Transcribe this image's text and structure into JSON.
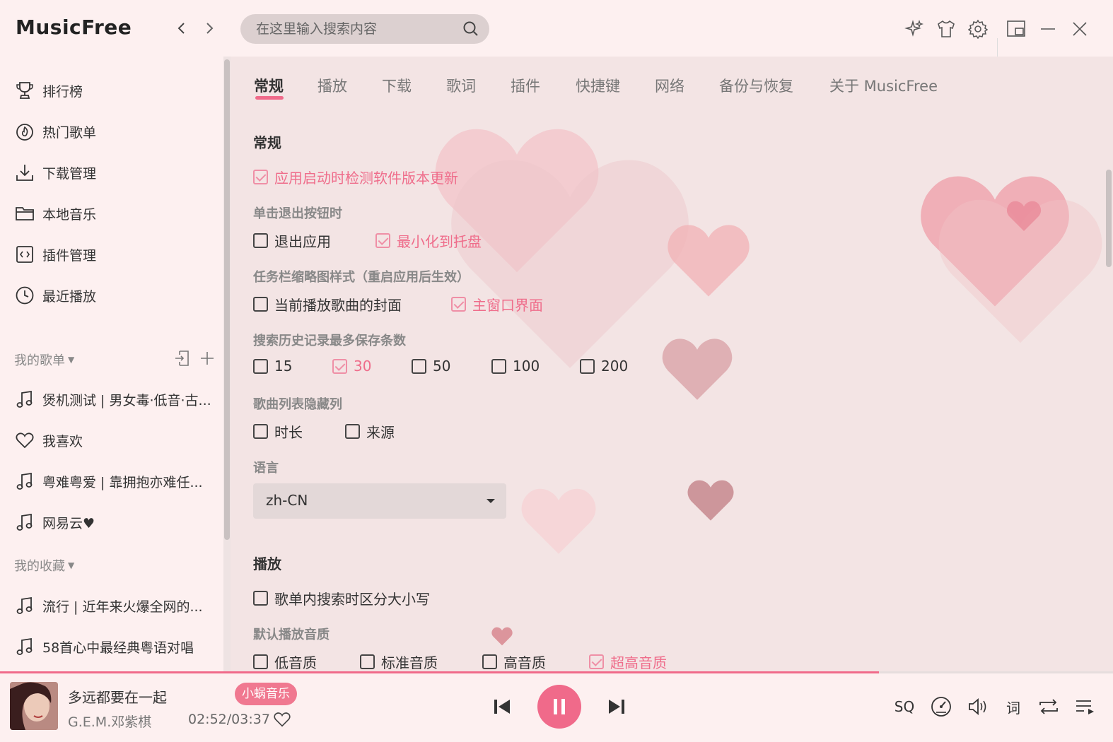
{
  "app": {
    "title": "MusicFree"
  },
  "search": {
    "placeholder": "在这里输入搜索内容"
  },
  "sidebar": {
    "items": [
      {
        "label": "排行榜",
        "icon": "trophy-icon"
      },
      {
        "label": "热门歌单",
        "icon": "fire-icon"
      },
      {
        "label": "下载管理",
        "icon": "download-icon"
      },
      {
        "label": "本地音乐",
        "icon": "folder-icon"
      },
      {
        "label": "插件管理",
        "icon": "plugin-icon"
      },
      {
        "label": "最近播放",
        "icon": "clock-icon"
      }
    ],
    "my_playlists": {
      "title": "我的歌单",
      "items": [
        {
          "label": "煲机测试 | 男女毒·低音·古...",
          "icon": "music-note-icon"
        },
        {
          "label": "我喜欢",
          "icon": "heart-icon"
        },
        {
          "label": "粤难粤爱 | 靠拥抱亦难任...",
          "icon": "music-note-icon"
        },
        {
          "label": "网易云♥",
          "icon": "music-note-icon"
        }
      ]
    },
    "my_favorites": {
      "title": "我的收藏",
      "items": [
        {
          "label": "流行 | 近年来火爆全网的...",
          "icon": "music-note-icon"
        },
        {
          "label": "58首心中最经典粤语对唱",
          "icon": "music-note-icon"
        }
      ]
    }
  },
  "tabs": [
    "常规",
    "播放",
    "下载",
    "歌词",
    "插件",
    "快捷键",
    "网络",
    "备份与恢复",
    "关于 MusicFree"
  ],
  "active_tab": "常规",
  "settings": {
    "general_title": "常规",
    "check_update": {
      "label": "应用启动时检测软件版本更新",
      "checked": true
    },
    "exit_title": "单击退出按钮时",
    "exit_opts": [
      {
        "label": "退出应用",
        "checked": false
      },
      {
        "label": "最小化到托盘",
        "checked": true
      }
    ],
    "taskbar_title": "任务栏缩略图样式（重启应用后生效）",
    "taskbar_opts": [
      {
        "label": "当前播放歌曲的封面",
        "checked": false
      },
      {
        "label": "主窗口界面",
        "checked": true
      }
    ],
    "history_title": "搜索历史记录最多保存条数",
    "history_opts": [
      {
        "label": "15",
        "checked": false
      },
      {
        "label": "30",
        "checked": true
      },
      {
        "label": "50",
        "checked": false
      },
      {
        "label": "100",
        "checked": false
      },
      {
        "label": "200",
        "checked": false
      }
    ],
    "hidden_cols_title": "歌曲列表隐藏列",
    "hidden_cols_opts": [
      {
        "label": "时长",
        "checked": false
      },
      {
        "label": "来源",
        "checked": false
      }
    ],
    "language_title": "语言",
    "language_value": "zh-CN",
    "playback_title": "播放",
    "case_sensitive": {
      "label": "歌单内搜索时区分大小写",
      "checked": false
    },
    "quality_title": "默认播放音质",
    "quality_opts": [
      {
        "label": "低音质",
        "checked": false
      },
      {
        "label": "标准音质",
        "checked": false
      },
      {
        "label": "高音质",
        "checked": false
      },
      {
        "label": "超高音质",
        "checked": true
      }
    ]
  },
  "player": {
    "song_title": "多远都要在一起",
    "artist": "G.E.M.邓紫棋",
    "source_tag": "小蜗音乐",
    "time": "02:52/03:37",
    "progress": 0.79,
    "quality_label": "SQ",
    "lyrics_label": "词"
  },
  "colors": {
    "accent": "#f06a8a",
    "checked_text": "#ef6d8b"
  }
}
